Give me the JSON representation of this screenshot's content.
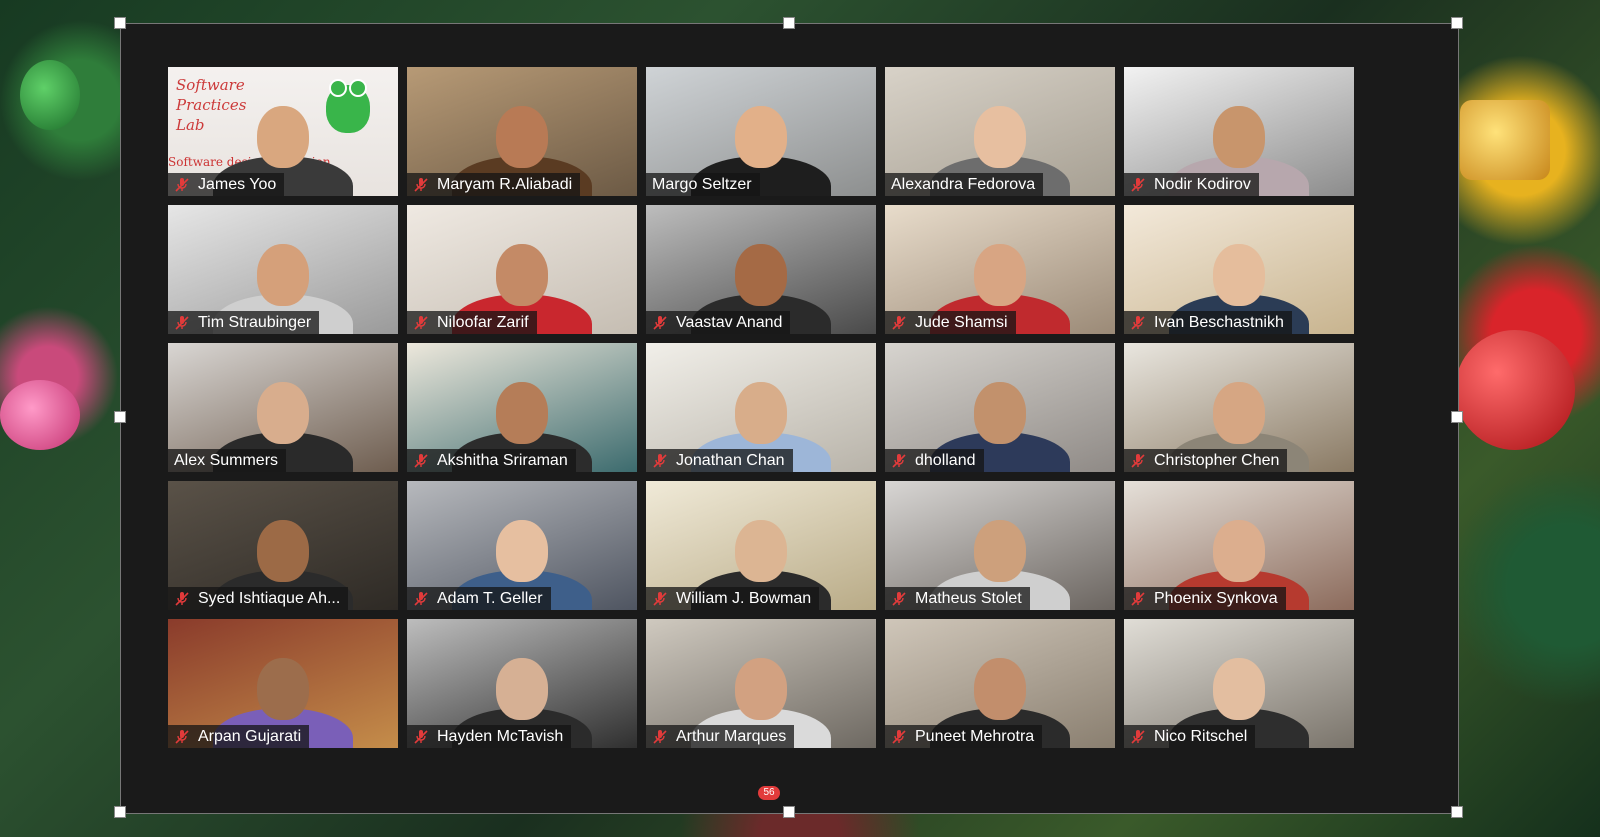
{
  "participants": [
    {
      "name": "James Yoo",
      "muted": true
    },
    {
      "name": "Maryam R.Aliabadi",
      "muted": true
    },
    {
      "name": "Margo Seltzer",
      "muted": false,
      "active_speaker": true
    },
    {
      "name": "Alexandra Fedorova",
      "muted": false
    },
    {
      "name": "Nodir Kodirov",
      "muted": true
    },
    {
      "name": "Tim Straubinger",
      "muted": true
    },
    {
      "name": "Niloofar Zarif",
      "muted": true
    },
    {
      "name": "Vaastav Anand",
      "muted": true
    },
    {
      "name": "Jude Shamsi",
      "muted": true
    },
    {
      "name": "Ivan Beschastnikh",
      "muted": true
    },
    {
      "name": "Alex Summers",
      "muted": false
    },
    {
      "name": "Akshitha Sriraman",
      "muted": true
    },
    {
      "name": "Jonathan Chan",
      "muted": true
    },
    {
      "name": "dholland",
      "muted": true
    },
    {
      "name": "Christopher Chen",
      "muted": true
    },
    {
      "name": "Syed Ishtiaque Ah...",
      "muted": true
    },
    {
      "name": "Adam T. Geller",
      "muted": true
    },
    {
      "name": "William J. Bowman",
      "muted": true
    },
    {
      "name": "Matheus Stolet",
      "muted": true
    },
    {
      "name": "Phoenix Synkova",
      "muted": true
    },
    {
      "name": "Arpan Gujarati",
      "muted": true
    },
    {
      "name": "Hayden McTavish",
      "muted": true
    },
    {
      "name": "Arthur Marques",
      "muted": true
    },
    {
      "name": "Puneet Mehrotra",
      "muted": true
    },
    {
      "name": "Nico Ritschel",
      "muted": true
    }
  ],
  "virtual_background_1": {
    "line1": "Software",
    "line2": "Practices",
    "line3": "Lab",
    "tagline": "Software design is passion"
  },
  "chat_badge": "56",
  "colors": {
    "active_speaker_border": "#d6e65b",
    "muted_icon": "#e23b3b",
    "name_tag_bg": "rgba(20,20,20,0.75)"
  }
}
